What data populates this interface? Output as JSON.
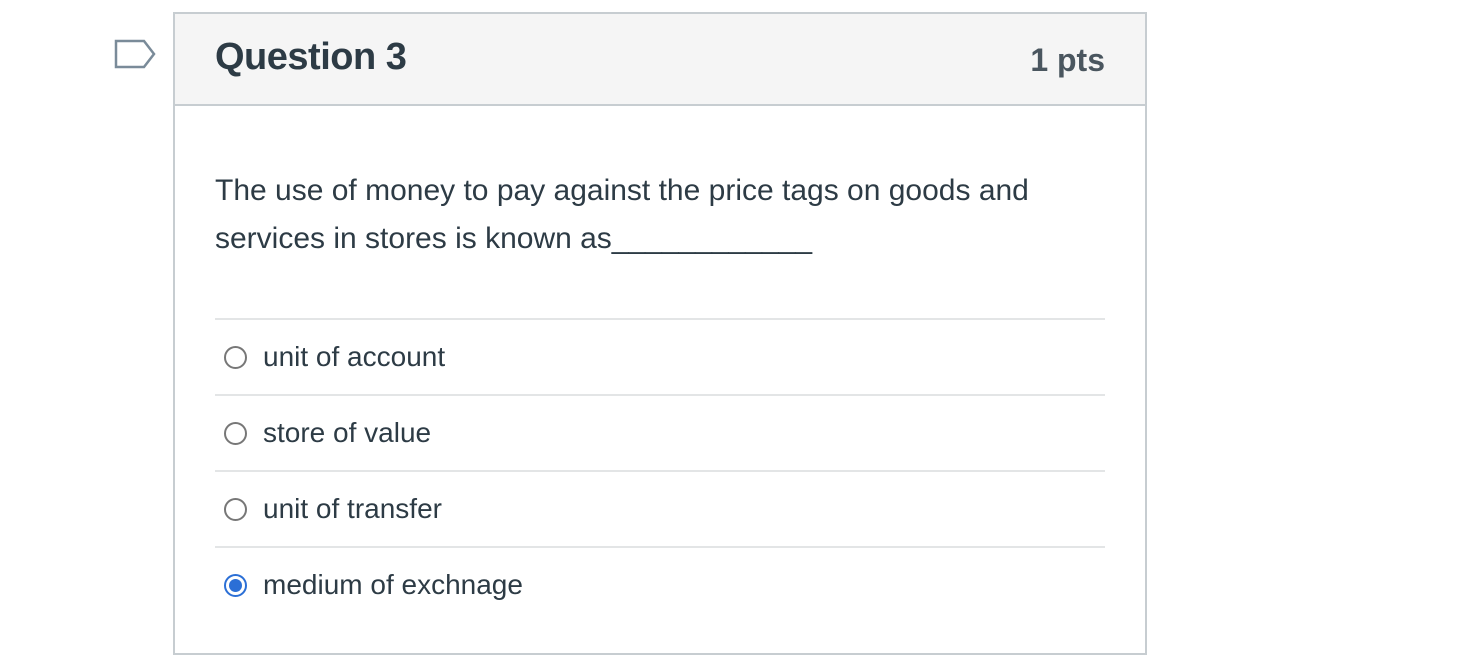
{
  "question": {
    "title": "Question 3",
    "points": "1 pts",
    "text": "The use of money to pay against the price tags on goods and services in stores is known as____________",
    "flag_icon": "flag-bookmark-icon",
    "answers": [
      {
        "label": "unit of account",
        "selected": false
      },
      {
        "label": "store of value",
        "selected": false
      },
      {
        "label": "unit of transfer",
        "selected": false
      },
      {
        "label": "medium of exchnage",
        "selected": true
      }
    ]
  },
  "colors": {
    "accent": "#2b6fd6",
    "header_bg": "#f5f5f5",
    "border": "#c7cdd1",
    "text": "#2d3b45"
  }
}
